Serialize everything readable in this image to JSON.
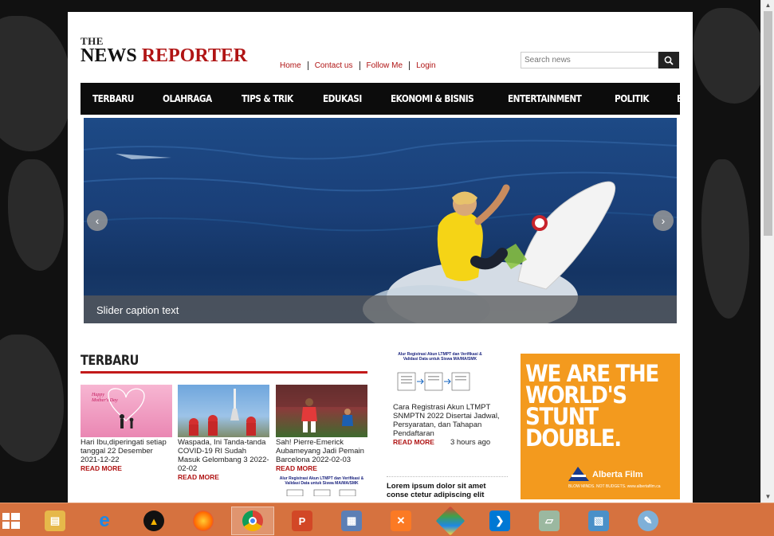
{
  "site": {
    "logo_the": "THE",
    "logo_word1": "NEWS",
    "logo_word2": "REPORTER"
  },
  "top_links": [
    "Home",
    "Contact us",
    "Follow Me",
    "Login"
  ],
  "search": {
    "placeholder": "Search news"
  },
  "nav_items": [
    "TERBARU",
    "OLAHRAGA",
    "TIPS & TRIK",
    "EDUKASI",
    "EKONOMI & BISNIS",
    "ENTERTAINMENT",
    "POLITIK",
    "BERITA DUNIA"
  ],
  "slider": {
    "caption": "Slider caption text",
    "prev": "‹",
    "next": "›"
  },
  "section": {
    "title": "TERBARU"
  },
  "cards": [
    {
      "text": "Hari Ibu,diperingati setiap tanggal 22 Desember 2021-12-22",
      "more": "READ MORE"
    },
    {
      "text": "Waspada, Ini Tanda-tanda COVID-19 RI Sudah Masuk Gelombang 3 2022-02-02",
      "more": "READ MORE"
    },
    {
      "text": "Sah! Pierre-Emerick Aubameyang Jadi Pemain Barcelona 2022-02-03",
      "more": "READ MORE"
    }
  ],
  "mid_card": {
    "image_text": "Alur Registrasi Akun LTMPT dan Verifikasi & Validasi Data untuk Siswa MA/MA/SMK",
    "text": "Cara Registrasi Akun LTMPT SNMPTN 2022 Disertai Jadwal, Persyaratan, dan Tahapan Pendaftaran",
    "more": "READ MORE",
    "time": "3 hours ago"
  },
  "card4_image_text": "Alur Registrasi Akun LTMPT dan Verifikasi & Validasi Data untuk Siswa MA/MA/SMK",
  "lorem": "Lorem ipsum dolor sit amet conse ctetur adipiscing elit",
  "ad": {
    "line1": "WE ARE THE",
    "line2": "WORLD'S",
    "line3": "STUNT",
    "line4": "DOUBLE.",
    "brand": "Alberta Film",
    "tagline": "BLOW MINDS. NOT BUDGETS.   www.albertafilm.ca"
  },
  "taskbar_apps": [
    "file-explorer",
    "internet-explorer",
    "app",
    "firefox",
    "chrome",
    "powerpoint",
    "network",
    "xampp",
    "app",
    "vscode",
    "app",
    "app",
    "paint"
  ],
  "colors": {
    "accent_red": "#b01414",
    "nav_bg": "#0c0c0c",
    "taskbar": "#d6723f",
    "ad_bg": "#f39a1e"
  }
}
